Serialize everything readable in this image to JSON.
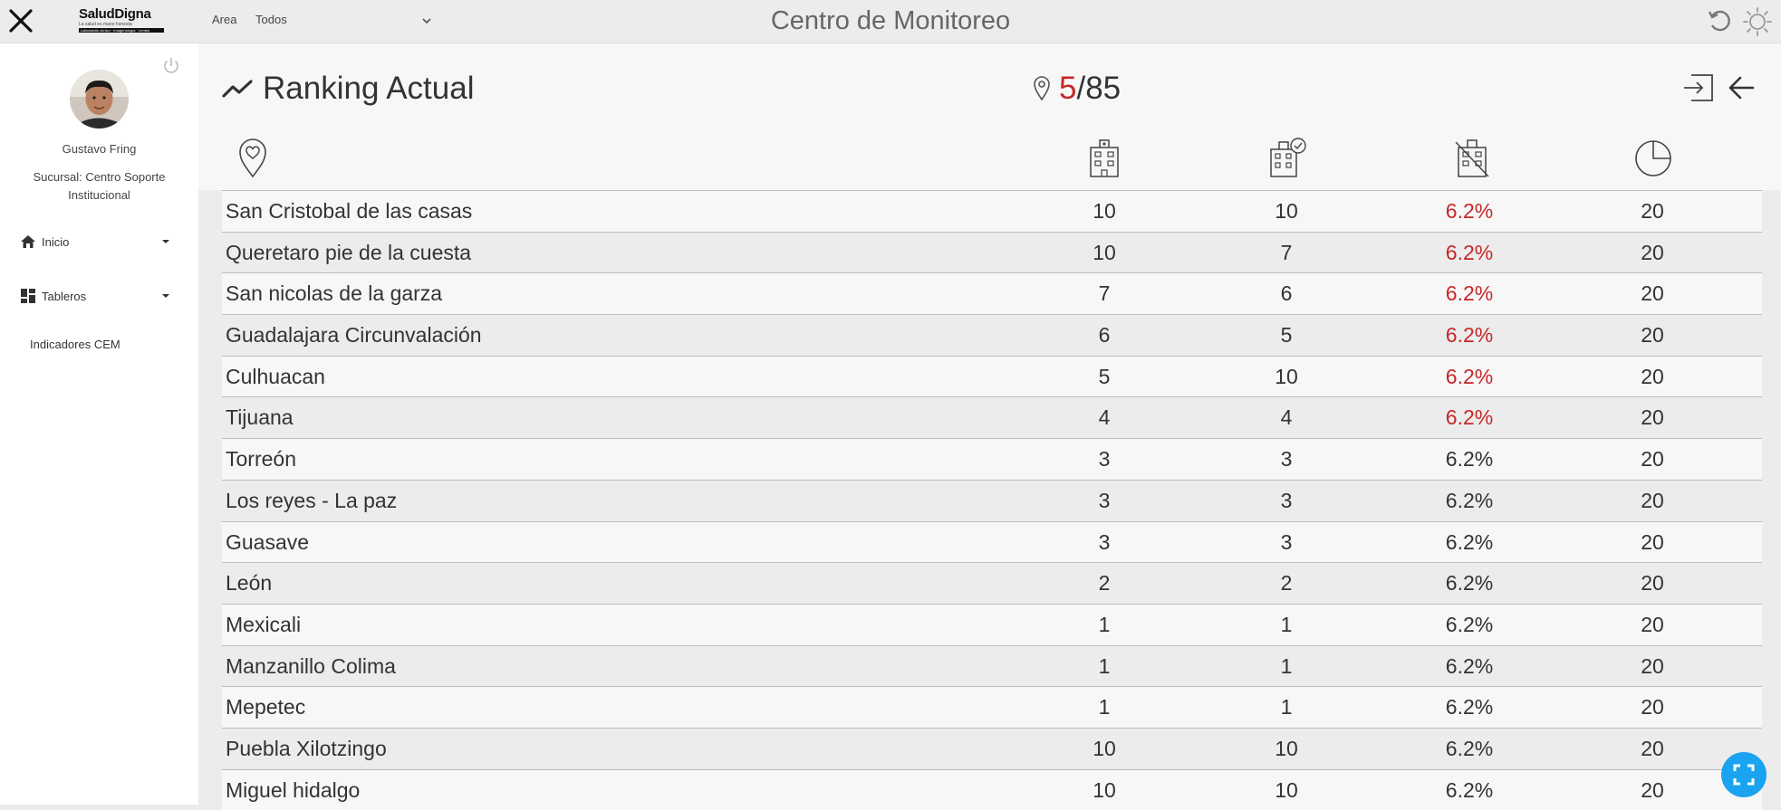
{
  "header": {
    "logo_brand": "SaludDigna",
    "logo_tagline": "La salud es mano honesta",
    "logo_bar_text": "Laboratorio clínico · Imagenología · Lentes",
    "area_label": "Area",
    "area_value": "Todos",
    "title": "Centro de Monitoreo"
  },
  "sidebar": {
    "user_name": "Gustavo Fring",
    "branch": "Sucursal: Centro Soporte Institucional",
    "nav": [
      {
        "label": "Inicio",
        "icon": "home-icon"
      },
      {
        "label": "Tableros",
        "icon": "dashboard-icon"
      }
    ],
    "sub_item": "Indicadores CEM"
  },
  "main": {
    "title": "Ranking Actual",
    "count_current": "5",
    "count_total": "/85",
    "column_icons": [
      "location-heart-icon",
      "hospital-icon",
      "hospital-check-icon",
      "hospital-off-icon",
      "pie-chart-icon"
    ],
    "rows": [
      {
        "name": "San Cristobal de las casas",
        "c1": "10",
        "c2": "10",
        "c3": "6.2%",
        "c4": "20",
        "highlight": true
      },
      {
        "name": "Queretaro pie de la cuesta",
        "c1": "10",
        "c2": "7",
        "c3": "6.2%",
        "c4": "20",
        "highlight": true
      },
      {
        "name": "San nicolas de la garza",
        "c1": "7",
        "c2": "6",
        "c3": "6.2%",
        "c4": "20",
        "highlight": true
      },
      {
        "name": "Guadalajara Circunvalación",
        "c1": "6",
        "c2": "5",
        "c3": "6.2%",
        "c4": "20",
        "highlight": true
      },
      {
        "name": "Culhuacan",
        "c1": "5",
        "c2": "10",
        "c3": "6.2%",
        "c4": "20",
        "highlight": true
      },
      {
        "name": "Tijuana",
        "c1": "4",
        "c2": "4",
        "c3": "6.2%",
        "c4": "20",
        "highlight": true
      },
      {
        "name": "Torreón",
        "c1": "3",
        "c2": "3",
        "c3": "6.2%",
        "c4": "20",
        "highlight": false
      },
      {
        "name": "Los reyes - La paz",
        "c1": "3",
        "c2": "3",
        "c3": "6.2%",
        "c4": "20",
        "highlight": false
      },
      {
        "name": "Guasave",
        "c1": "3",
        "c2": "3",
        "c3": "6.2%",
        "c4": "20",
        "highlight": false
      },
      {
        "name": "León",
        "c1": "2",
        "c2": "2",
        "c3": "6.2%",
        "c4": "20",
        "highlight": false
      },
      {
        "name": "Mexicali",
        "c1": "1",
        "c2": "1",
        "c3": "6.2%",
        "c4": "20",
        "highlight": false
      },
      {
        "name": "Manzanillo Colima",
        "c1": "1",
        "c2": "1",
        "c3": "6.2%",
        "c4": "20",
        "highlight": false
      },
      {
        "name": "Mepetec",
        "c1": "1",
        "c2": "1",
        "c3": "6.2%",
        "c4": "20",
        "highlight": false
      },
      {
        "name": "Puebla Xilotzingo",
        "c1": "10",
        "c2": "10",
        "c3": "6.2%",
        "c4": "20",
        "highlight": false
      },
      {
        "name": "Miguel hidalgo",
        "c1": "10",
        "c2": "10",
        "c3": "6.2%",
        "c4": "20",
        "highlight": false
      }
    ]
  },
  "colors": {
    "accent_red": "#c62828",
    "fab_blue": "#1aa3f0"
  }
}
